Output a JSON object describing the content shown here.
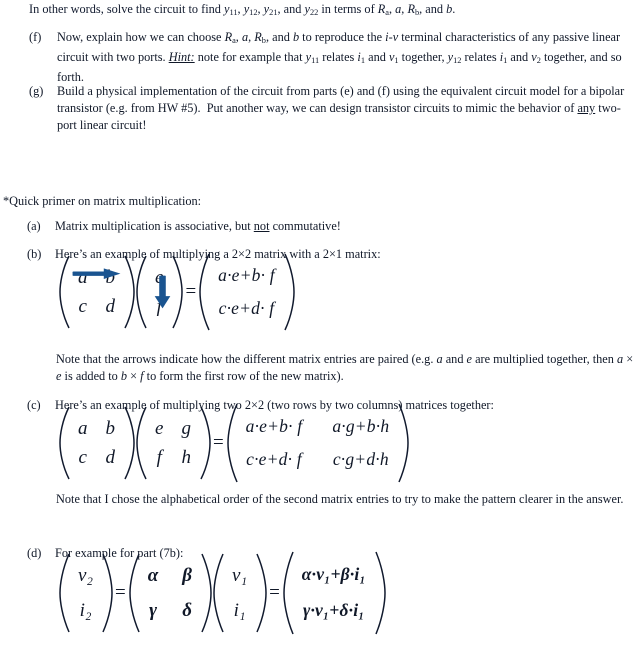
{
  "document": {
    "lead_text_parts": {
      "a": "In other words, solve the circuit to find ",
      "y11": "y",
      "s11": "11",
      "mid1": ", ",
      "y12": "y",
      "s12": "12",
      "mid2": ", ",
      "y21": "y",
      "s21": "21",
      "mid3": ", and ",
      "y22": "y",
      "s22": "22",
      "tail": " in terms of ",
      "Ra": "R",
      "sa": "a",
      "c1": ", ",
      "av": "a",
      "c2": ", ",
      "Rb": "R",
      "sb": "b",
      "c3": ", and ",
      "bv": "b",
      "period": "."
    },
    "items": [
      {
        "marker": "(f)",
        "text_plain": "Now, explain how we can choose Ra, a, Rb, and b to reproduce the i-v terminal characteristics of any passive linear circuit with two ports. Hint: note for example that y11 relates i1 and v1 together, y12 relates i1 and v2 together, and so forth."
      },
      {
        "marker": "(g)",
        "text_plain": "Build a physical implementation of the circuit from parts (e) and (f) using the equivalent circuit model for a bipolar transistor (e.g. from HW #5).  Put another way, we can design transistor circuits to mimic the behavior of any two-port linear circuit!"
      }
    ],
    "primer_heading": "*Quick primer on matrix multiplication:",
    "primer_items": [
      {
        "marker": "(a)",
        "text_plain": "Matrix multiplication is associative, but not commutative!"
      },
      {
        "marker": "(b)",
        "text_plain": "Here’s an example of multiplying a 2×2 matrix with a 2×1 matrix:"
      },
      {
        "marker": "(c)",
        "text_plain": "Here’s an example of multiplying two 2×2 (two rows by two columns) matrices together:"
      },
      {
        "marker": "(d)",
        "text_plain": "For example for part (7b):"
      }
    ],
    "note_b": "Note that the arrows indicate how the different matrix entries are paired (e.g. a and e are multiplied together, then a × e is added to b × f to form the first row of the new matrix).",
    "note_c": "Note that I chose the alphabetical order of the second matrix entries to try to make the pattern clearer in the answer."
  },
  "equations": {
    "eq_b": {
      "left_matrix": [
        [
          "a",
          "b"
        ],
        [
          "c",
          "d"
        ]
      ],
      "right_matrix": [
        [
          "e"
        ],
        [
          "f"
        ]
      ],
      "equals": "=",
      "result_matrix": [
        [
          "a·e+b· f"
        ],
        [
          "c·e+d· f"
        ]
      ],
      "arrow_color": "#1a5490",
      "arrow_row_label": "row-arrow",
      "arrow_col_label": "column-arrow"
    },
    "eq_c": {
      "left_matrix": [
        [
          "a",
          "b"
        ],
        [
          "c",
          "d"
        ]
      ],
      "right_matrix": [
        [
          "e",
          "g"
        ],
        [
          "f",
          "h"
        ]
      ],
      "equals": "=",
      "result_matrix": [
        [
          "a·e+b· f",
          "a·g+b·h"
        ],
        [
          "c·e+d· f",
          "c·g+d·h"
        ]
      ]
    },
    "eq_d": {
      "left_vector": [
        "v₂",
        "i₂"
      ],
      "equals1": "=",
      "coef_matrix": [
        [
          "α",
          "β"
        ],
        [
          "γ",
          "δ"
        ]
      ],
      "right_vector": [
        "v₁",
        "i₁"
      ],
      "equals2": "=",
      "result_vector": [
        "α·v₁+β·i₁",
        "γ·v₁+δ·i₁"
      ]
    }
  },
  "colors": {
    "text": "#111a2e",
    "arrow_blue": "#1a5490",
    "page_background": "#ffffff"
  }
}
